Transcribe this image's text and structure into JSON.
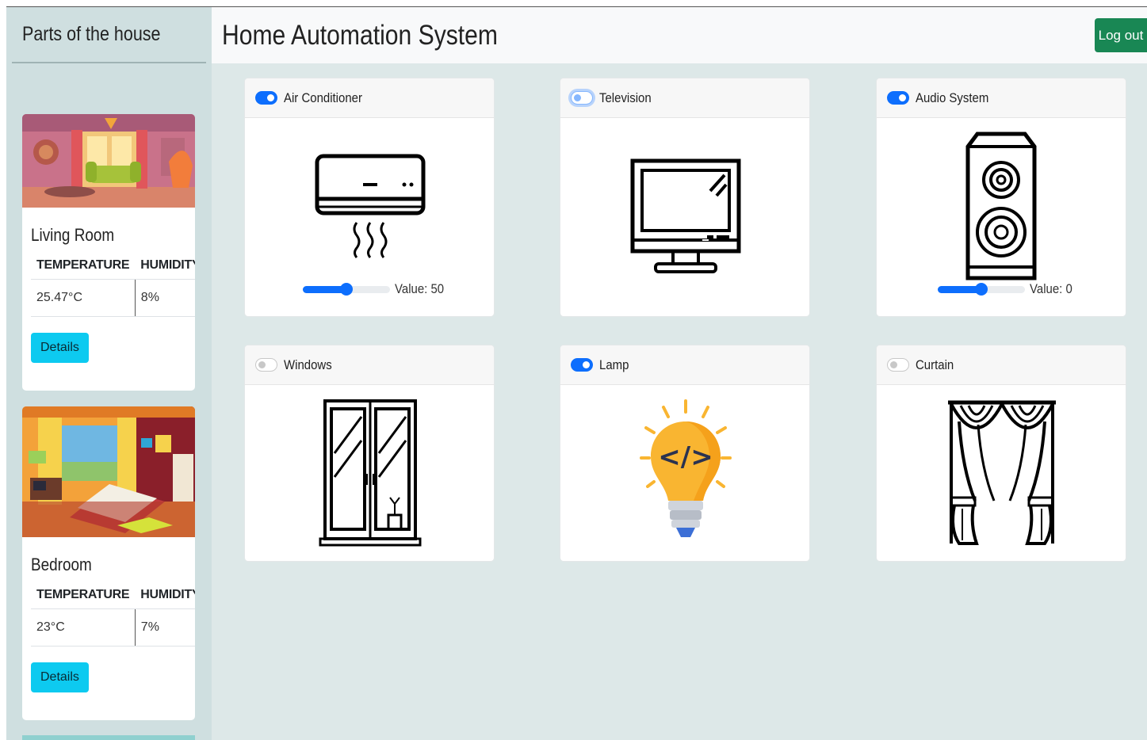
{
  "sidebar": {
    "title": "Parts of the house",
    "rooms": [
      {
        "name": "Living Room",
        "headers": [
          "TEMPERATURE",
          "HUMIDITY"
        ],
        "temperature": "25.47°C",
        "humidity": "8%",
        "button": "Details"
      },
      {
        "name": "Bedroom",
        "headers": [
          "TEMPERATURE",
          "HUMIDITY"
        ],
        "temperature": "23°C",
        "humidity": "7%",
        "button": "Details"
      }
    ]
  },
  "header": {
    "title": "Home Automation System",
    "logout": "Log out"
  },
  "devices": [
    {
      "label": "Air Conditioner",
      "on": true,
      "icon": "air-conditioner-icon",
      "slider": {
        "value": 50,
        "text": "Value: 50"
      }
    },
    {
      "label": "Television",
      "on": false,
      "icon": "television-icon"
    },
    {
      "label": "Audio System",
      "on": true,
      "icon": "speaker-icon",
      "slider": {
        "value": 50,
        "text": "Value: 0"
      }
    },
    {
      "label": "Windows",
      "on": false,
      "icon": "window-icon"
    },
    {
      "label": "Lamp",
      "on": true,
      "icon": "lightbulb-code-icon"
    },
    {
      "label": "Curtain",
      "on": false,
      "icon": "curtain-icon"
    }
  ],
  "colors": {
    "primary": "#0d6efd",
    "info": "#0dcaf0",
    "success": "#198754",
    "sidebar_bg": "#cfdfe0",
    "main_bg": "#dde8e8",
    "bulb": "#f9b531"
  }
}
